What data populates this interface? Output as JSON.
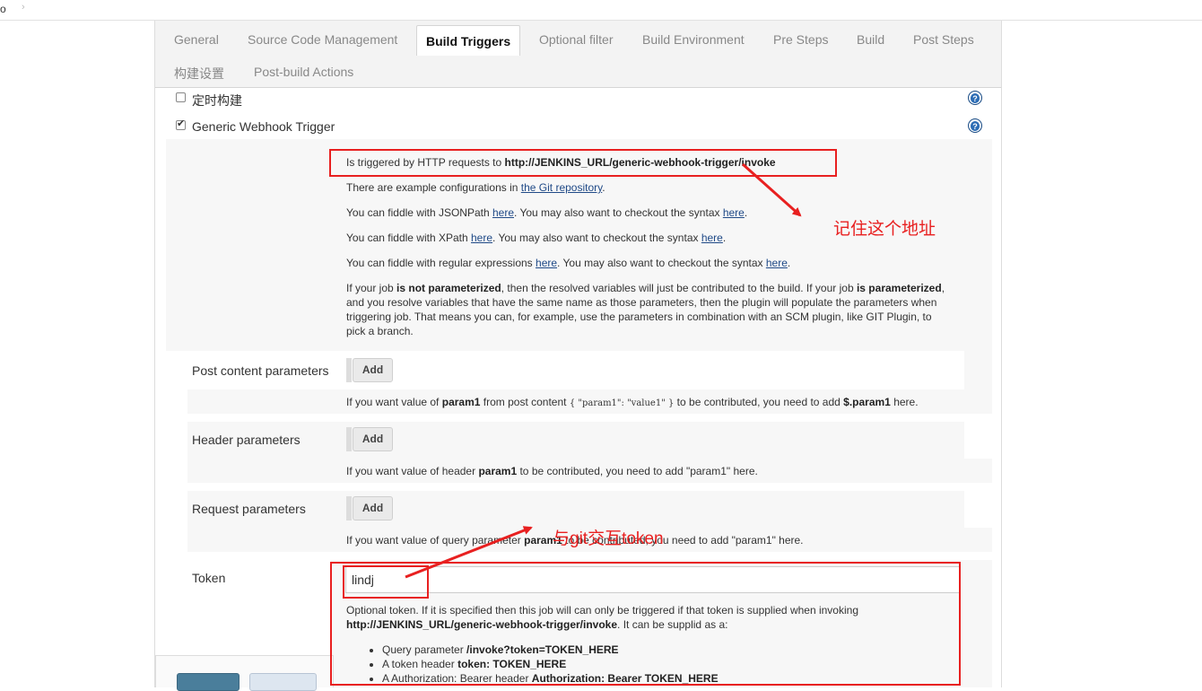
{
  "topbar": {
    "crumb": "o",
    "chevron": "›"
  },
  "tabs": [
    {
      "label": "General"
    },
    {
      "label": "Source Code Management"
    },
    {
      "label": "Build Triggers"
    },
    {
      "label": "Optional filter"
    },
    {
      "label": "Build Environment"
    },
    {
      "label": "Pre Steps"
    },
    {
      "label": "Build"
    },
    {
      "label": "Post Steps"
    },
    {
      "label": "构建设置"
    },
    {
      "label": "Post-build Actions"
    }
  ],
  "triggers": {
    "scheduled_label": "定时构建",
    "webhook_label": "Generic Webhook Trigger",
    "help_glyph": "?"
  },
  "info": {
    "line1_prefix": "Is triggered by HTTP requests to ",
    "line1_url": "http://JENKINS_URL/generic-webhook-trigger/invoke",
    "line2_prefix": "There are example configurations in ",
    "line2_link": "the Git repository",
    "line2_suffix": ".",
    "jsonpath_prefix": "You can fiddle with JSONPath ",
    "xpath_prefix": "You can fiddle with XPath ",
    "regex_prefix": "You can fiddle with regular expressions ",
    "here": "here",
    "syntax_mid": ". You may also want to checkout the syntax ",
    "dot": ".",
    "para_1": "If your job ",
    "para_b1": "is not parameterized",
    "para_2": ", then the resolved variables will just be contributed to the build. If your job ",
    "para_b2": "is parameterized",
    "para_3": ", and you resolve variables that have the same name as those parameters, then the plugin will populate the parameters when triggering job. That means you can, for example, use the parameters in combination with an SCM plugin, like GIT Plugin, to pick a branch."
  },
  "post_content": {
    "label": "Post content parameters",
    "add": "Add",
    "d1": "If you want value of ",
    "b1": "param1",
    "d2": " from post content ",
    "code": "{ \"param1\": \"value1\" }",
    "d3": " to be contributed, you need to add ",
    "b2": "$.param1",
    "d4": " here."
  },
  "header_params": {
    "label": "Header parameters",
    "add": "Add",
    "d1": "If you want value of header ",
    "b1": "param1",
    "d2": " to be contributed, you need to add \"param1\" here."
  },
  "request_params": {
    "label": "Request parameters",
    "add": "Add",
    "d1": "If you want value of query parameter ",
    "b1": "param1",
    "d2": " to be contributed, you need to add \"param1\" here."
  },
  "token": {
    "label": "Token",
    "value": "lindj",
    "desc1": "Optional token. If it is specified then this job will can only be triggered if that token is supplied when invoking ",
    "desc_b": "http://JENKINS_URL/generic-webhook-trigger/invoke",
    "desc2": ". It can be supplid as a:",
    "items": [
      {
        "pre": "Query parameter ",
        "b": "/invoke?token=TOKEN_HERE"
      },
      {
        "pre": "A token header ",
        "b": "token: TOKEN_HERE"
      },
      {
        "pre": "A Authorization: Bearer header ",
        "b": "Authorization: Bearer TOKEN_HERE"
      }
    ]
  },
  "annotations": {
    "remember": "记住这个地址",
    "token_note": "与git交互token"
  },
  "colors": {
    "accent": "#e82020",
    "help": "#2d6db5",
    "link": "#204a87"
  }
}
